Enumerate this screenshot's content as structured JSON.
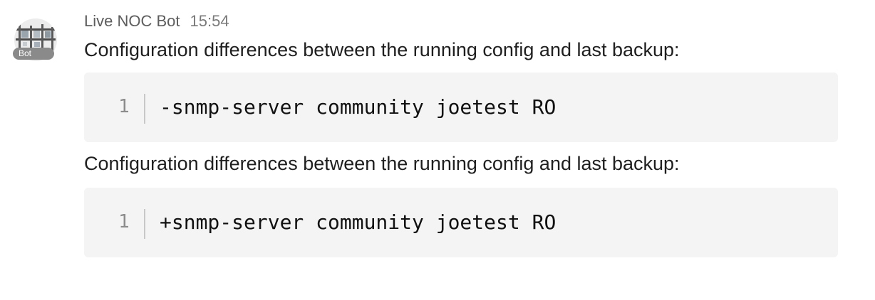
{
  "message": {
    "sender": "Live NOC Bot",
    "timestamp": "15:54",
    "bot_badge": "Bot",
    "avatar_icon": "bot-avatar-icon"
  },
  "blocks": [
    {
      "text": "Configuration differences between the running config and last backup:",
      "code": {
        "line_number": "1",
        "content": "-snmp-server community joetest RO"
      }
    },
    {
      "text": "Configuration differences between the running config and last backup:",
      "code": {
        "line_number": "1",
        "content": "+snmp-server community joetest RO"
      }
    }
  ],
  "colors": {
    "code_background": "#f4f4f4",
    "sender_text": "#5d5d5d",
    "badge_background": "#8a8a8a"
  }
}
